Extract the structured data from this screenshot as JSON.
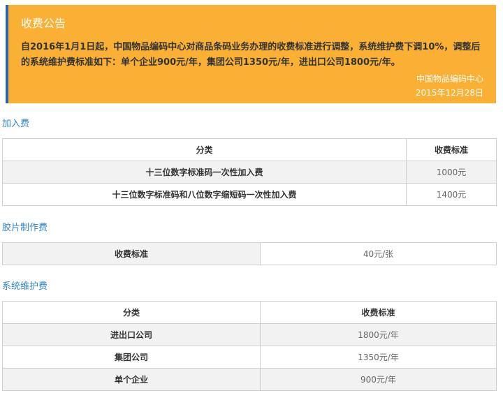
{
  "notice": {
    "title": "收费公告",
    "body": "自2016年1月1日起，中国物品编码中心对商品条码业务办理的收费标准进行调整，系统维护费下调10%，调整后的系统维护费标准如下：单个企业900元/年，集团公司1350元/年，进出口公司1800元/年。",
    "issuer": "中国物品编码中心",
    "date": "2015年12月28日"
  },
  "joining_fee": {
    "section_title": "加入费",
    "header": {
      "category": "分类",
      "standard": "收费标准"
    },
    "rows": [
      {
        "category": "十三位数字标准码一次性加入费",
        "standard": "1000元"
      },
      {
        "category": "十三位数字标准码和八位数字缩短码一次性加入费",
        "standard": "1400元"
      }
    ]
  },
  "film_fee": {
    "section_title": "胶片制作费",
    "label": "收费标准",
    "value": "40元/张"
  },
  "maintenance_fee": {
    "section_title": "系统维护费",
    "header": {
      "category": "分类",
      "standard": "收费标准"
    },
    "rows": [
      {
        "category": "进出口公司",
        "standard": "1800元/年"
      },
      {
        "category": "集团公司",
        "standard": "1350元/年"
      },
      {
        "category": "单个企业",
        "standard": "900元/年"
      }
    ]
  }
}
